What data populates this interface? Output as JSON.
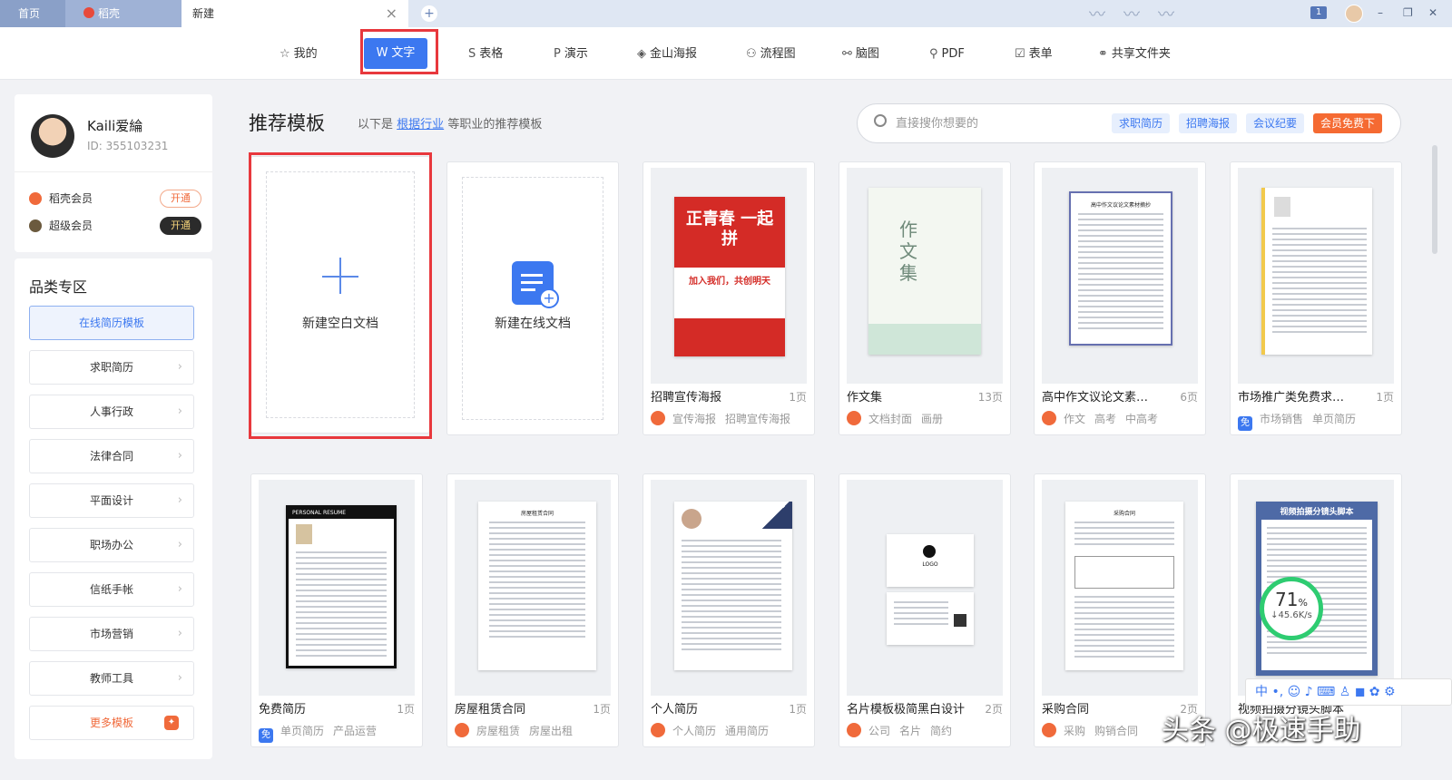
{
  "tabs": {
    "home": "首页",
    "daoke": "稻壳",
    "new": "新建",
    "close": "×",
    "add": "+"
  },
  "window": {
    "count": "1",
    "minimize": "–",
    "restore": "❐",
    "close": "✕"
  },
  "nav": [
    {
      "label": "我的",
      "icon": "☆"
    },
    {
      "label": "文字",
      "icon": "W"
    },
    {
      "label": "表格",
      "icon": "S"
    },
    {
      "label": "演示",
      "icon": "P"
    },
    {
      "label": "金山海报",
      "icon": "◈"
    },
    {
      "label": "流程图",
      "icon": "⚇"
    },
    {
      "label": "脑图",
      "icon": "⚯"
    },
    {
      "label": "PDF",
      "icon": "⚲"
    },
    {
      "label": "表单",
      "icon": "☑"
    },
    {
      "label": "共享文件夹",
      "icon": "⚭"
    }
  ],
  "profile": {
    "name": "Kaili爱綸",
    "id": "ID: 355103231",
    "members": [
      {
        "label": "稻壳会员",
        "btn": "开通",
        "color": "#f06a3b"
      },
      {
        "label": "超级会员",
        "btn": "开通",
        "color": "#6b5a3e"
      }
    ]
  },
  "categories": {
    "title": "品类专区",
    "items": [
      "在线简历模板",
      "求职简历",
      "人事行政",
      "法律合同",
      "平面设计",
      "职场办公",
      "信纸手帐",
      "市场营销",
      "教师工具",
      "更多模板"
    ]
  },
  "section": {
    "title": "推荐模板",
    "sub_prefix": "以下是",
    "sub_link": "根据行业",
    "sub_suffix": "等职业的推荐模板"
  },
  "search": {
    "placeholder": "直接搜你想要的",
    "tags": [
      "求职简历",
      "招聘海报",
      "会议纪要",
      "会员免费下"
    ]
  },
  "blank": {
    "new_blank": "新建空白文档",
    "new_online": "新建在线文档"
  },
  "cards": [
    {
      "name": "招聘宣传海报",
      "pages": "1页",
      "tags": [
        "宣传海报",
        "招聘宣传海报"
      ],
      "free": false,
      "poster": {
        "head": "正青春 一起拼",
        "slogan": "加入我们，共创明天"
      }
    },
    {
      "name": "作文集",
      "pages": "13页",
      "tags": [
        "文档封面",
        "画册"
      ],
      "free": false,
      "cover": "作文集"
    },
    {
      "name": "高中作文议论文素材摘...",
      "pages": "6页",
      "tags": [
        "作文",
        "高考",
        "中高考"
      ],
      "free": false,
      "doc_title": "高中作文议论文素材摘抄"
    },
    {
      "name": "市场推广类免费求职简...",
      "pages": "1页",
      "tags": [
        "市场销售",
        "单页简历"
      ],
      "free": true
    },
    {
      "name": "免费简历",
      "pages": "1页",
      "tags": [
        "单页简历",
        "产品运营"
      ],
      "free": true,
      "header": "PERSONAL RESUME"
    },
    {
      "name": "房屋租赁合同",
      "pages": "1页",
      "tags": [
        "房屋租赁",
        "房屋出租"
      ],
      "free": false,
      "doc_title": "房屋租赁合同"
    },
    {
      "name": "个人简历",
      "pages": "1页",
      "tags": [
        "个人简历",
        "通用简历"
      ],
      "free": false
    },
    {
      "name": "名片模板极简黑白设计",
      "pages": "2页",
      "tags": [
        "公司",
        "名片",
        "简约"
      ],
      "free": false,
      "logo": "LOGO"
    },
    {
      "name": "采购合同",
      "pages": "2页",
      "tags": [
        "采购",
        "购销合同"
      ],
      "free": false,
      "doc_title": "采购合同"
    },
    {
      "name": "视频拍摄分镜头脚本",
      "pages": "",
      "tags": [],
      "free": false,
      "header": "视频拍摄分镜头脚本"
    }
  ],
  "free_icon": "免",
  "overlay": {
    "progress": "71",
    "unit": "%",
    "speed": "↓45.6K/s",
    "ime": "中 •, ☺ ♪ ⌨ ♙ ◼ ✿ ⚙",
    "watermark": "头条 @极速手助"
  },
  "colors": {
    "accent": "#3c78f0",
    "highlight": "#e8383d",
    "orange": "#f06a3b"
  }
}
